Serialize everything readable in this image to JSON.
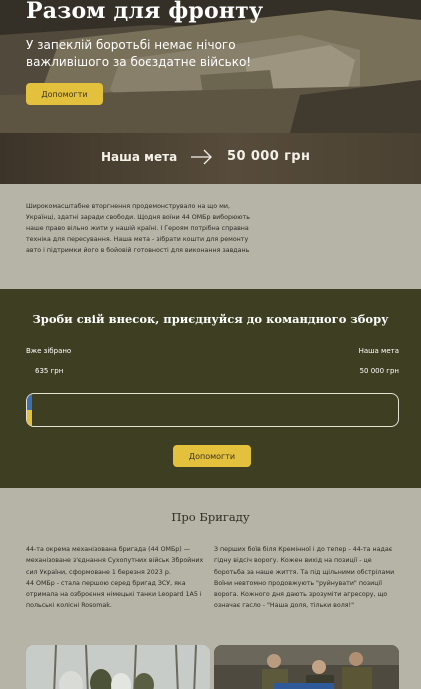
{
  "hero": {
    "title": "Разом для фронту",
    "subtitle": "У запеклій боротьбі немає нічого важливішого за боєздатне військо!",
    "button_label": "Допомогти"
  },
  "goal_band": {
    "label": "Наша мета",
    "icon": "arrow-right-icon",
    "value": "50 000 грн"
  },
  "intro_text": "Широкомасштабне вторгнення продемонструвало на що ми, Українці, здатні заради свободи. Щодня воїни 44 ОМБр виборюють наше право вільно жити у нашій країні. І Героям потрібна справна техніка для пересування. Наша мета - зібрати кошти для ремонту авто і підтримки його в бойовій готовності для виконання завдань",
  "donate": {
    "title": "Зроби свій внесок, приєднуйся до командного збору",
    "collected_label": "Вже зібрано",
    "goal_label": "Наша мета",
    "collected_value": "635 грн",
    "goal_value": "50 000 грн",
    "progress": 0.0127,
    "button_label": "Допомогти"
  },
  "brigade": {
    "title": "Про Бригаду",
    "left_text": "44-та окрема механізована бригада (44 ОМБр) — механізоване з'єднання Сухопутних військ Збройних сил України, сформоване 1 березня 2023 р.\n44 ОМБр - стала першою серед бригад ЗСУ, яка отримала на озброєння німецькі танки Leopard 1A5 і польські колісні Rosomak.",
    "right_text": "З перших боїв біля Кремінної і до тепер - 44-та надає гідну відсіч ворогу. Кожен вихід на позиції - це боротьба за наше життя. Та під щільними обстрілами Воїни невтомно продовжують \"руйнувати\" позиції ворога. Кожного дня дають зрозуміти агресору, що означає гасло - \"Наша доля, тільки воля!\""
  },
  "colors": {
    "accent": "#e4c13c",
    "donate_bg": "#3e3f22",
    "page_bg": "#b6b4a7"
  }
}
